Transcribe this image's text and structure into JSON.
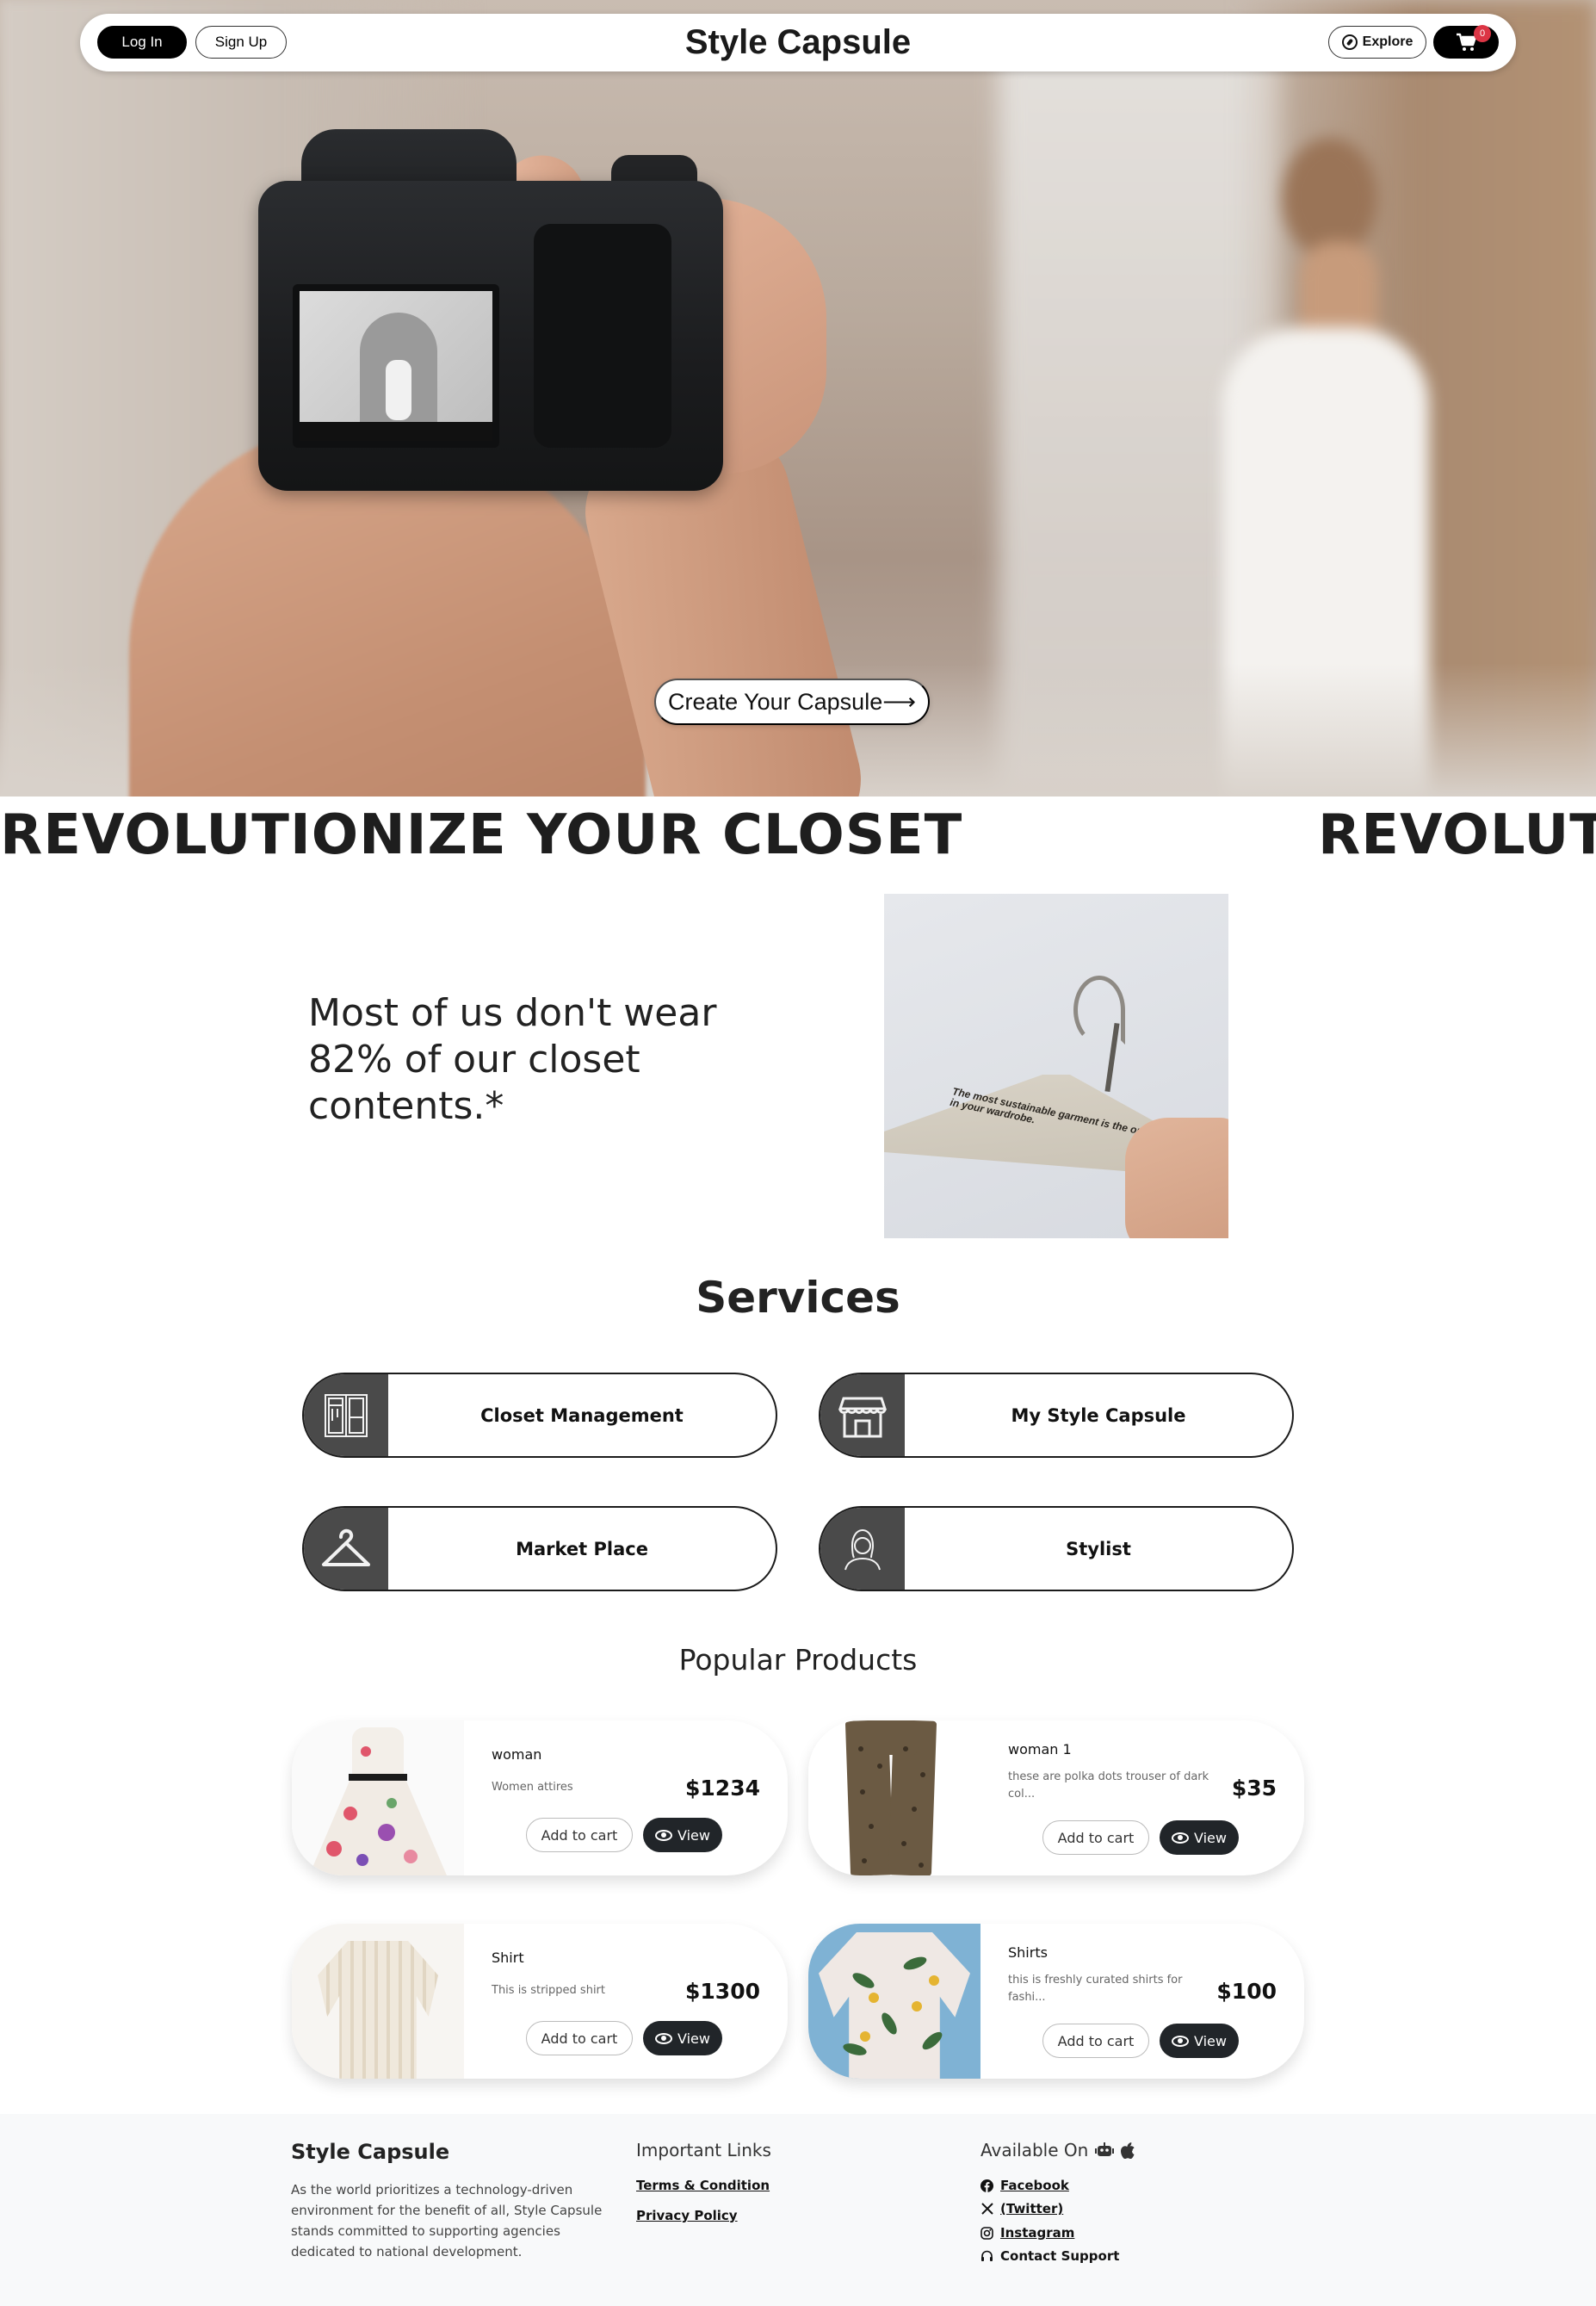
{
  "nav": {
    "login_label": "Log In",
    "signup_label": "Sign Up",
    "brand": "Style Capsule",
    "explore_label": "Explore",
    "cart_count": "0"
  },
  "hero": {
    "cta_label": "Create Your Capsule⟶"
  },
  "marquee": {
    "text": "REVOLUTIONIZE YOUR CLOSET"
  },
  "stat": {
    "text": "Most of us don't wear 82% of our closet contents.*",
    "image_caption": "The most sustainable garment is the one already in your wardrobe."
  },
  "services": {
    "title": "Services",
    "items": [
      {
        "label": "Closet Management",
        "icon": "wardrobe-icon"
      },
      {
        "label": "My Style Capsule",
        "icon": "store-icon"
      },
      {
        "label": "Market Place",
        "icon": "hanger-icon"
      },
      {
        "label": "Stylist",
        "icon": "stylist-icon"
      }
    ]
  },
  "products": {
    "title": "Popular Products",
    "add_label": "Add to cart",
    "view_label": "View",
    "items": [
      {
        "name": "woman",
        "desc": "Women attires",
        "price": "$1234",
        "image": "floral-dress"
      },
      {
        "name": "woman 1",
        "desc": "these are polka dots trouser of dark col...",
        "price": "$35",
        "image": "polka-dot-trousers"
      },
      {
        "name": "Shirt",
        "desc": "This is stripped shirt",
        "price": "$1300",
        "image": "striped-shirt"
      },
      {
        "name": "Shirts",
        "desc": "this is freshly curated shirts for fashi...",
        "price": "$100",
        "image": "hawaiian-shirt"
      }
    ]
  },
  "footer": {
    "brand": "Style Capsule",
    "about": "As the world prioritizes a technology-driven environment for the benefit of all, Style Capsule stands committed to supporting agencies dedicated to national development.",
    "links_heading": "Important Links",
    "links": [
      "Terms & Condition",
      "Privacy Policy"
    ],
    "available_heading": "Available On",
    "social": [
      "Facebook",
      "(Twitter)",
      "Instagram",
      "Contact Support"
    ]
  }
}
